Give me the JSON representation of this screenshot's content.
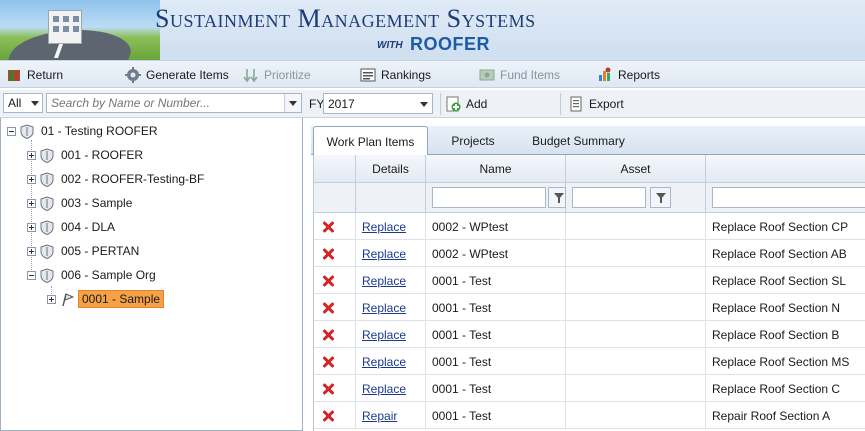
{
  "banner": {
    "title": "Sustainment Management Systems",
    "with": "WITH",
    "product": "ROOFER"
  },
  "toolbar": {
    "items": [
      {
        "label": "Return",
        "icon": "return-icon",
        "enabled": true
      },
      {
        "label": "Generate Items",
        "icon": "gear-icon",
        "enabled": true
      },
      {
        "label": "Prioritize",
        "icon": "prioritize-icon",
        "enabled": false
      },
      {
        "label": "Rankings",
        "icon": "rankings-icon",
        "enabled": true
      },
      {
        "label": "Fund Items",
        "icon": "fund-items-icon",
        "enabled": false
      },
      {
        "label": "Reports",
        "icon": "reports-icon",
        "enabled": true
      }
    ]
  },
  "search": {
    "filter_value": "All",
    "placeholder": "Search by Name or Number..."
  },
  "fy": {
    "label": "FY",
    "value": "2017",
    "add_label": "Add",
    "export_label": "Export"
  },
  "tree": {
    "root": "01 - Testing ROOFER",
    "children": [
      "001 - ROOFER",
      "002 - ROOFER-Testing-BF",
      "003 - Sample",
      "004 - DLA",
      "005 - PERTAN",
      "006 - Sample Org"
    ],
    "selected": "0001 - Sample"
  },
  "tabs": [
    {
      "label": "Work Plan Items",
      "active": true
    },
    {
      "label": "Projects",
      "active": false
    },
    {
      "label": "Budget Summary",
      "active": false
    }
  ],
  "grid": {
    "columns": [
      "Details",
      "Name",
      "Asset"
    ],
    "rows": [
      {
        "details": "Replace",
        "name": "0002 - WPtest",
        "asset": "",
        "description": "Replace Roof Section CP"
      },
      {
        "details": "Replace",
        "name": "0002 - WPtest",
        "asset": "",
        "description": "Replace Roof Section AB"
      },
      {
        "details": "Replace",
        "name": "0001 - Test",
        "asset": "",
        "description": "Replace Roof Section SL"
      },
      {
        "details": "Replace",
        "name": "0001 - Test",
        "asset": "",
        "description": "Replace Roof Section N"
      },
      {
        "details": "Replace",
        "name": "0001 - Test",
        "asset": "",
        "description": "Replace Roof Section B"
      },
      {
        "details": "Replace",
        "name": "0001 - Test",
        "asset": "",
        "description": "Replace Roof Section MS"
      },
      {
        "details": "Replace",
        "name": "0001 - Test",
        "asset": "",
        "description": "Replace Roof Section C"
      },
      {
        "details": "Repair",
        "name": "0001 - Test",
        "asset": "",
        "description": "Repair Roof Section A"
      }
    ]
  },
  "colors": {
    "selected_node": "#f5a146",
    "delete_icon": "#d42424",
    "link": "#1a3a8f"
  }
}
